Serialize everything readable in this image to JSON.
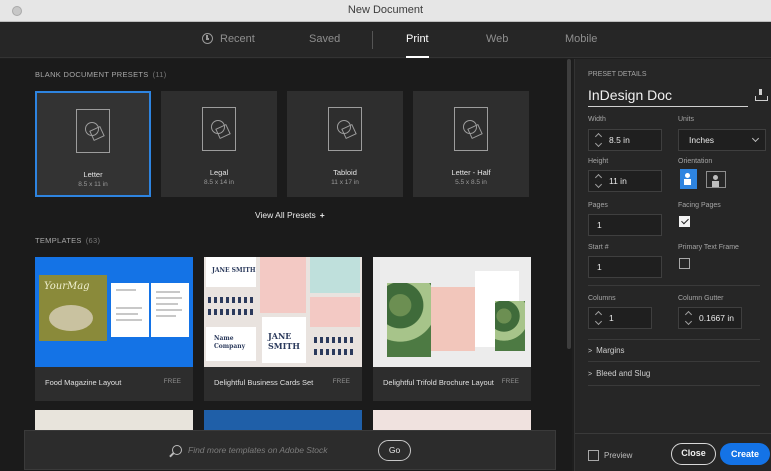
{
  "window": {
    "title": "New Document"
  },
  "tabs": [
    {
      "label": "Recent",
      "icon": "clock-icon"
    },
    {
      "label": "Saved"
    },
    {
      "label": "Print",
      "active": true
    },
    {
      "label": "Web"
    },
    {
      "label": "Mobile"
    }
  ],
  "presets": {
    "heading": "BLANK DOCUMENT PRESETS",
    "count": "(11)",
    "items": [
      {
        "name": "Letter",
        "size": "8.5 x 11 in",
        "selected": true
      },
      {
        "name": "Legal",
        "size": "8.5 x 14 in"
      },
      {
        "name": "Tabloid",
        "size": "11 x 17 in"
      },
      {
        "name": "Letter - Half",
        "size": "5.5 x 8.5 in"
      }
    ],
    "view_all": "View All Presets",
    "view_all_icon": "+"
  },
  "templates": {
    "heading": "TEMPLATES",
    "count": "(63)",
    "items": [
      {
        "name": "Food Magazine Layout",
        "badge": "FREE",
        "cover_text": "YourMag"
      },
      {
        "name": "Delightful Business Cards Set",
        "badge": "FREE",
        "card_texts": [
          "JANE SMITH",
          "Name Company",
          "JANE SMITH"
        ]
      },
      {
        "name": "Delightful Trifold Brochure Layout",
        "badge": "FREE"
      }
    ]
  },
  "search": {
    "placeholder": "Find more templates on Adobe Stock",
    "go_label": "Go"
  },
  "details": {
    "heading": "PRESET DETAILS",
    "doc_name": "InDesign Doc",
    "width_label": "Width",
    "width_value": "8.5 in",
    "units_label": "Units",
    "units_value": "Inches",
    "height_label": "Height",
    "height_value": "11 in",
    "orientation_label": "Orientation",
    "orientation_value": "portrait",
    "pages_label": "Pages",
    "pages_value": "1",
    "facing_label": "Facing Pages",
    "facing_checked": true,
    "start_label": "Start #",
    "start_value": "1",
    "primary_label": "Primary Text Frame",
    "primary_checked": false,
    "columns_label": "Columns",
    "columns_value": "1",
    "gutter_label": "Column Gutter",
    "gutter_value": "0.1667 in",
    "margins_label": "Margins",
    "bleed_label": "Bleed and Slug",
    "preview_label": "Preview",
    "close_label": "Close",
    "create_label": "Create"
  },
  "colors": {
    "accent": "#1473e6",
    "selection": "#2e84e0",
    "panel": "#262626",
    "background": "#1b1b1b"
  }
}
